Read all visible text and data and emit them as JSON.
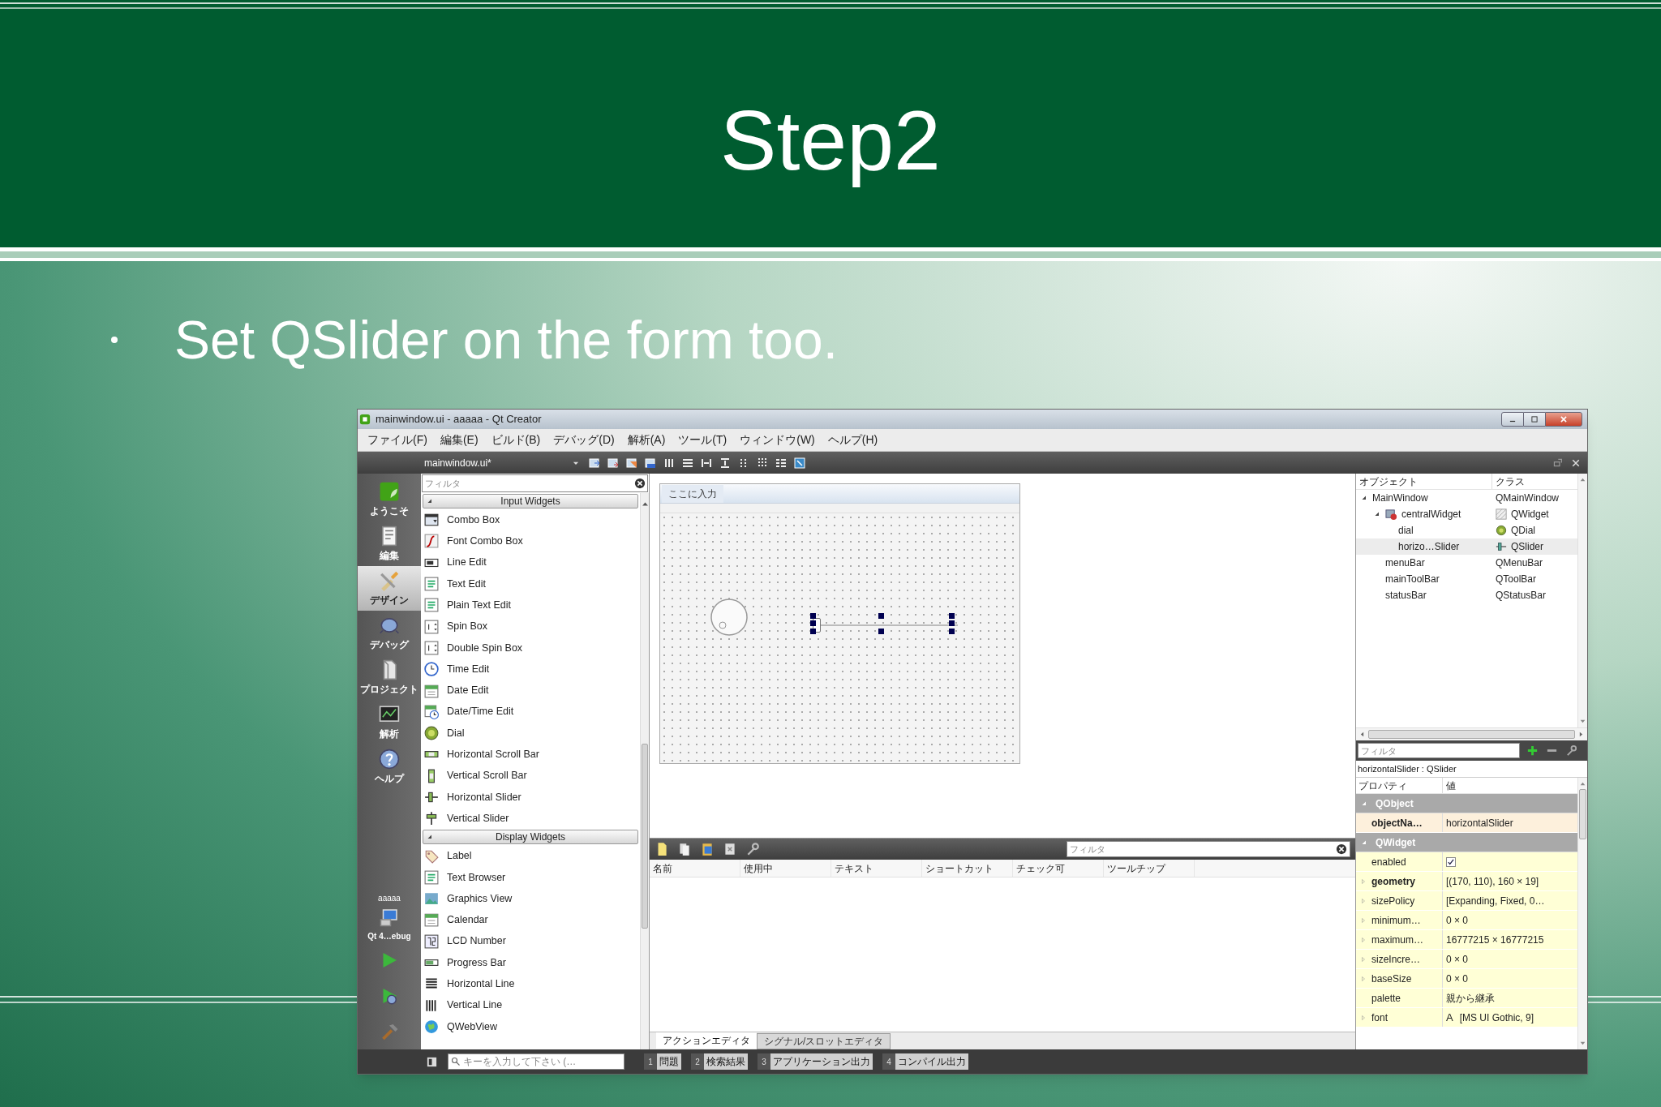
{
  "slide": {
    "title": "Step2",
    "bullets": [
      "Set QSlider on the form too."
    ]
  },
  "window": {
    "title": "mainwindow.ui - aaaaa - Qt Creator",
    "menu": [
      "ファイル(F)",
      "編集(E)",
      "ビルド(B)",
      "デバッグ(D)",
      "解析(A)",
      "ツール(T)",
      "ウィンドウ(W)",
      "ヘルプ(H)"
    ],
    "file_tab": "mainwindow.ui*",
    "mode_bar": [
      {
        "label": "ようこそ",
        "selected": false
      },
      {
        "label": "編集",
        "selected": false
      },
      {
        "label": "デザイン",
        "selected": true
      },
      {
        "label": "デバッグ",
        "selected": false
      },
      {
        "label": "プロジェクト",
        "selected": false
      },
      {
        "label": "解析",
        "selected": false
      },
      {
        "label": "ヘルプ",
        "selected": false
      }
    ],
    "kit": {
      "project": "aaaaa",
      "target": "Qt 4…ebug"
    },
    "widget_box": {
      "filter_placeholder": "フィルタ",
      "groups": [
        {
          "title": "Input Widgets",
          "expanded": true,
          "items": [
            "Combo Box",
            "Font Combo Box",
            "Line Edit",
            "Text Edit",
            "Plain Text Edit",
            "Spin Box",
            "Double Spin Box",
            "Time Edit",
            "Date Edit",
            "Date/Time Edit",
            "Dial",
            "Horizontal Scroll Bar",
            "Vertical Scroll Bar",
            "Horizontal Slider",
            "Vertical Slider"
          ]
        },
        {
          "title": "Display Widgets",
          "expanded": true,
          "items": [
            "Label",
            "Text Browser",
            "Graphics View",
            "Calendar",
            "LCD Number",
            "Progress Bar",
            "Horizontal Line",
            "Vertical Line",
            "QWebView"
          ]
        }
      ]
    },
    "form": {
      "menu_placeholder": "ここに入力",
      "slider": {
        "level": 0
      }
    },
    "action_editor": {
      "filter_placeholder": "フィルタ",
      "columns": [
        "名前",
        "使用中",
        "テキスト",
        "ショートカット",
        "チェック可",
        "ツールチップ"
      ],
      "tabs": [
        {
          "label": "アクションエディタ",
          "selected": true
        },
        {
          "label": "シグナル/スロットエディタ",
          "selected": false
        }
      ]
    },
    "object_inspector": {
      "columns": [
        "オブジェクト",
        "クラス"
      ],
      "tree": [
        {
          "name": "MainWindow",
          "class": "QMainWindow",
          "expanded": true,
          "selected": false,
          "children": [
            {
              "name": "centralWidget",
              "class": "QWidget",
              "kind": "widget",
              "expanded": true,
              "selected": false,
              "children": [
                {
                  "name": "dial",
                  "class": "QDial",
                  "kind": "dial",
                  "selected": false
                },
                {
                  "name": "horizo…Slider",
                  "class": "QSlider",
                  "kind": "slider",
                  "selected": true
                }
              ]
            },
            {
              "name": "menuBar",
              "class": "QMenuBar",
              "selected": false
            },
            {
              "name": "mainToolBar",
              "class": "QToolBar",
              "selected": false
            },
            {
              "name": "statusBar",
              "class": "QStatusBar",
              "selected": false
            }
          ]
        }
      ]
    },
    "property_editor": {
      "filter_placeholder": "フィルタ",
      "object_label": "horizontalSlider : QSlider",
      "columns": [
        "プロパティ",
        "値"
      ],
      "rows": [
        {
          "kind": "group",
          "name": "QObject",
          "expanded": true
        },
        {
          "kind": "text",
          "name": "objectNa…",
          "value": "horizontalSlider",
          "modified": true,
          "expandable": false
        },
        {
          "kind": "group",
          "name": "QWidget",
          "expanded": true
        },
        {
          "kind": "checkbox",
          "name": "enabled",
          "checked": true,
          "modified": false,
          "expandable": false
        },
        {
          "kind": "text",
          "name": "geometry",
          "value": "[(170, 110), 160 × 19]",
          "modified": true,
          "expandable": true
        },
        {
          "kind": "text",
          "name": "sizePolicy",
          "value": "[Expanding, Fixed, 0…",
          "modified": false,
          "expandable": true
        },
        {
          "kind": "text",
          "name": "minimum…",
          "value": "0 × 0",
          "modified": false,
          "expandable": true
        },
        {
          "kind": "text",
          "name": "maximum…",
          "value": "16777215 × 16777215",
          "modified": false,
          "expandable": true
        },
        {
          "kind": "text",
          "name": "sizeIncre…",
          "value": "0 × 0",
          "modified": false,
          "expandable": true
        },
        {
          "kind": "text",
          "name": "baseSize",
          "value": "0 × 0",
          "modified": false,
          "expandable": true
        },
        {
          "kind": "text",
          "name": "palette",
          "value": "親から継承",
          "modified": false,
          "expandable": false
        },
        {
          "kind": "font",
          "name": "font",
          "preview": "A",
          "value": "[MS UI Gothic, 9]",
          "modified": false,
          "expandable": true
        }
      ]
    },
    "output_bar": {
      "search_placeholder": "キーを入力して下さい (…",
      "panes": [
        {
          "number": "1",
          "label": "問題"
        },
        {
          "number": "2",
          "label": "検索結果"
        },
        {
          "number": "3",
          "label": "アプリケーション出力"
        },
        {
          "number": "4",
          "label": "コンパイル出力"
        }
      ]
    }
  }
}
